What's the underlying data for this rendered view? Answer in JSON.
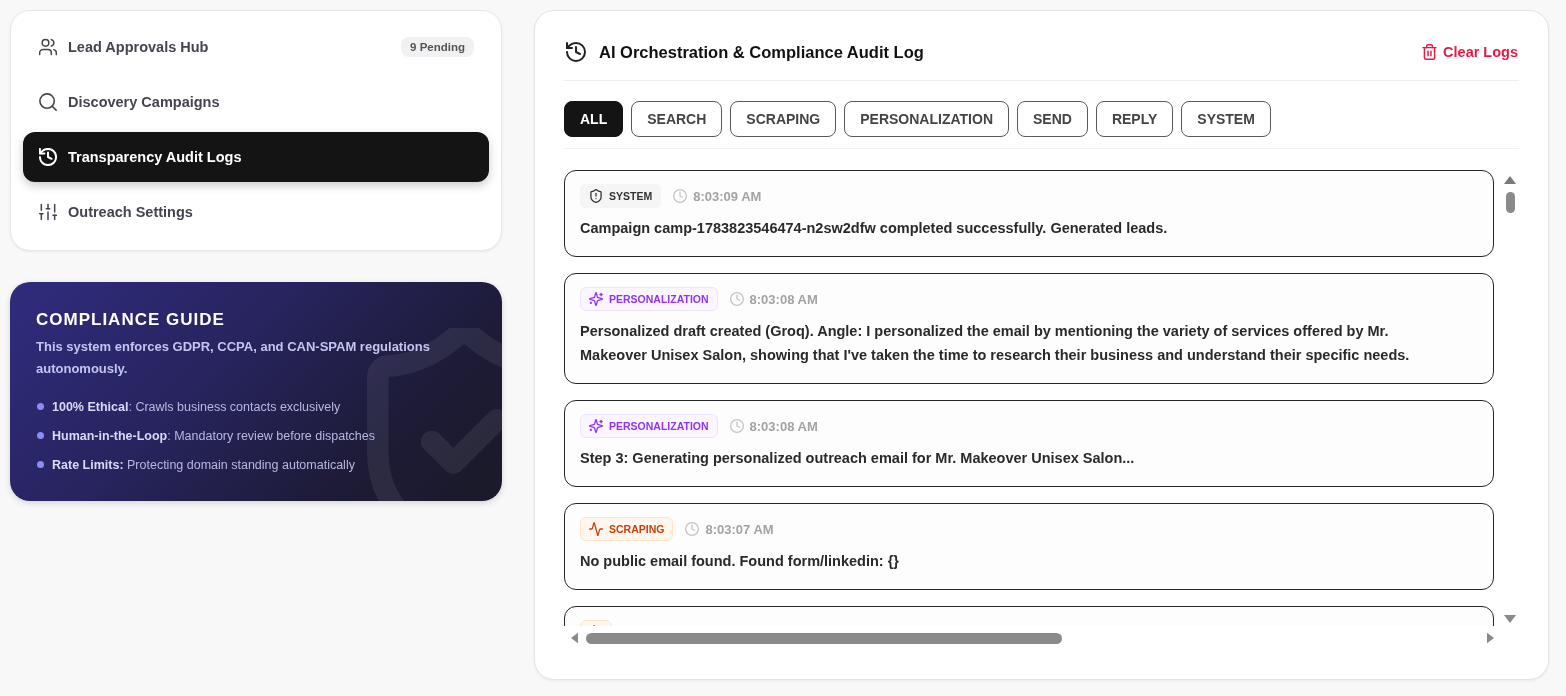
{
  "sidebar": {
    "items": [
      {
        "label": "Lead Approvals Hub",
        "badge": "9 Pending",
        "selected": false
      },
      {
        "label": "Discovery Campaigns",
        "selected": false
      },
      {
        "label": "Transparency Audit Logs",
        "selected": true
      },
      {
        "label": "Outreach Settings",
        "selected": false
      }
    ]
  },
  "compliance_guide": {
    "title": "COMPLIANCE GUIDE",
    "description": "This system enforces GDPR, CCPA, and CAN-SPAM regulations autonomously.",
    "points": [
      "**100% Ethical**: Crawls business contacts exclusively",
      "**Human-in-the-Loop**: Mandatory review before dispatches",
      "**Rate Limits:** Protecting domain standing automatically"
    ]
  },
  "audit_log": {
    "title": "AI Orchestration & Compliance Audit Log",
    "clear_button": "Clear Logs",
    "filters": [
      {
        "label": "ALL",
        "selected": true
      },
      {
        "label": "SEARCH",
        "selected": false
      },
      {
        "label": "SCRAPING",
        "selected": false
      },
      {
        "label": "PERSONALIZATION",
        "selected": false
      },
      {
        "label": "SEND",
        "selected": false
      },
      {
        "label": "REPLY",
        "selected": false
      },
      {
        "label": "SYSTEM",
        "selected": false
      }
    ],
    "entries": [
      {
        "kind": "system",
        "tag": "SYSTEM",
        "time": "8:03:09 AM",
        "message": "Campaign camp-1783823546474-n2sw2dfw completed successfully. Generated leads."
      },
      {
        "kind": "personalization",
        "tag": "PERSONALIZATION",
        "time": "8:03:08 AM",
        "message": "Personalized draft created (Groq). Angle: I personalized the email by mentioning the variety of services offered by Mr. Makeover Unisex Salon, showing that I've taken the time to research their business and understand their specific needs."
      },
      {
        "kind": "personalization",
        "tag": "PERSONALIZATION",
        "time": "8:03:08 AM",
        "message": "Step 3: Generating personalized outreach email for Mr. Makeover Unisex Salon..."
      },
      {
        "kind": "scraping",
        "tag": "SCRAPING",
        "time": "8:03:07 AM",
        "message": "No public email found. Found form/linkedin: {}"
      },
      {
        "kind": "scraping"
      }
    ]
  }
}
